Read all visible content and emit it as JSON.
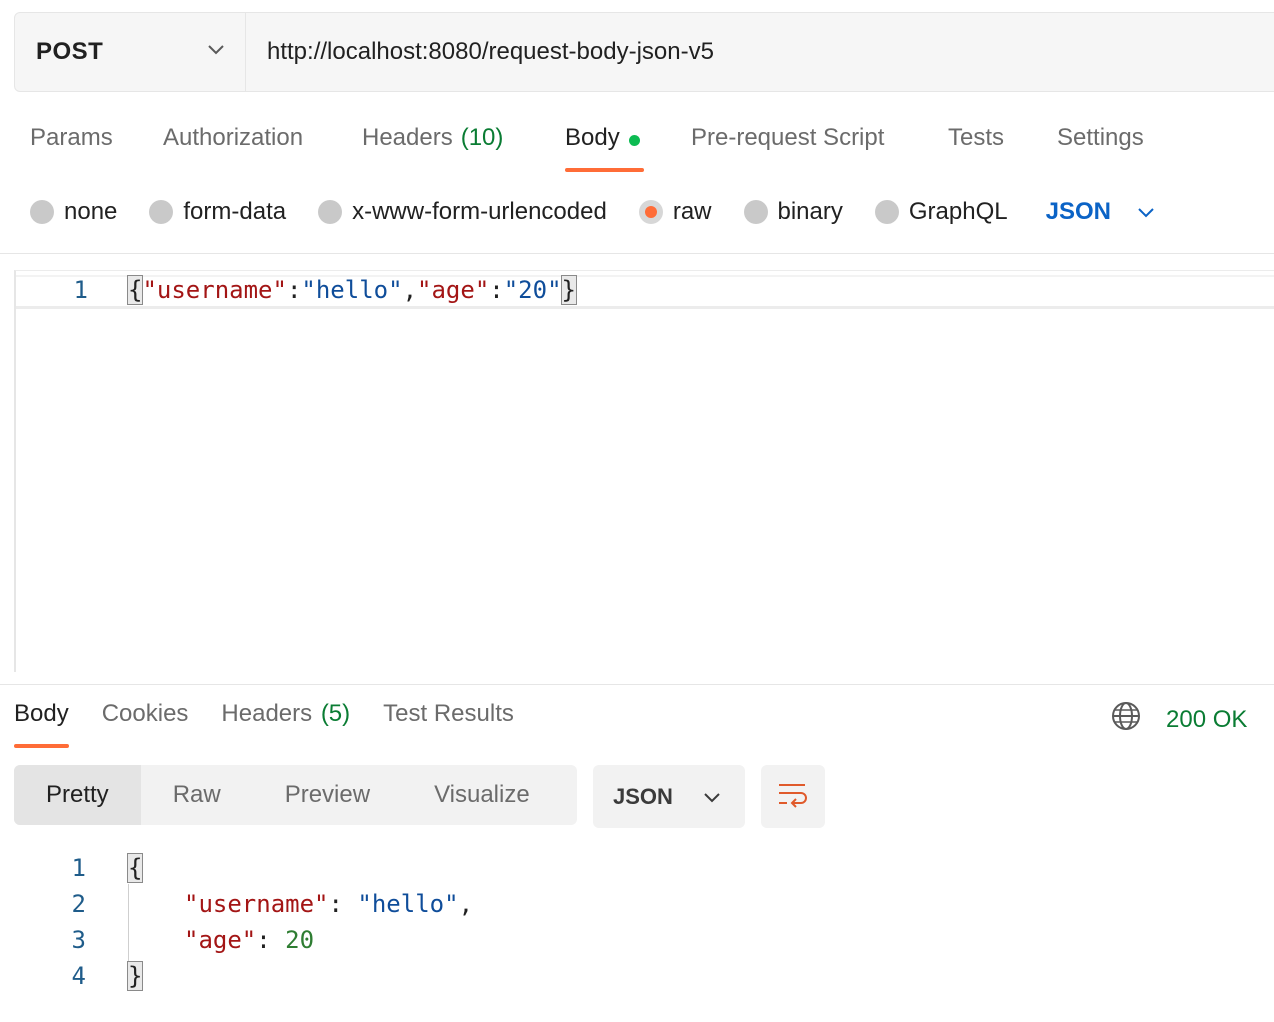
{
  "request": {
    "method": "POST",
    "url": "http://localhost:8080/request-body-json-v5"
  },
  "request_tabs": [
    {
      "label": "Params"
    },
    {
      "label": "Authorization"
    },
    {
      "label": "Headers",
      "count": "(10)"
    },
    {
      "label": "Body",
      "active": true,
      "indicator": "green-dot"
    },
    {
      "label": "Pre-request Script"
    },
    {
      "label": "Tests"
    },
    {
      "label": "Settings"
    }
  ],
  "body_types": [
    {
      "label": "none"
    },
    {
      "label": "form-data"
    },
    {
      "label": "x-www-form-urlencoded"
    },
    {
      "label": "raw",
      "selected": true
    },
    {
      "label": "binary"
    },
    {
      "label": "GraphQL"
    }
  ],
  "body_format": "JSON",
  "request_body": {
    "line_number": "1",
    "open": "{",
    "key1": "\"username\"",
    "colon1": ":",
    "val1": "\"hello\"",
    "comma": ",",
    "key2": "\"age\"",
    "colon2": ":",
    "val2": "\"20\"",
    "close": "}"
  },
  "response_tabs": [
    {
      "label": "Body",
      "active": true
    },
    {
      "label": "Cookies"
    },
    {
      "label": "Headers",
      "count": "(5)"
    },
    {
      "label": "Test Results"
    }
  ],
  "response_status": "200 OK",
  "view_modes": [
    {
      "label": "Pretty",
      "active": true
    },
    {
      "label": "Raw"
    },
    {
      "label": "Preview"
    },
    {
      "label": "Visualize"
    }
  ],
  "response_format": "JSON",
  "response_body": {
    "line_numbers": [
      "1",
      "2",
      "3",
      "4"
    ],
    "open": "{",
    "key1": "\"username\"",
    "colon1": ":",
    "val1": "\"hello\"",
    "comma": ",",
    "key2": "\"age\"",
    "colon2": ":",
    "val2": "20",
    "close": "}"
  },
  "colors": {
    "accent": "#ff6c37",
    "link_blue": "#0b63c6",
    "status_green": "#0a7c33",
    "json_key": "#a31515",
    "json_string": "#0f4d9a"
  },
  "icons": [
    "chevron-down-icon",
    "globe-icon",
    "wrap-lines-icon"
  ]
}
